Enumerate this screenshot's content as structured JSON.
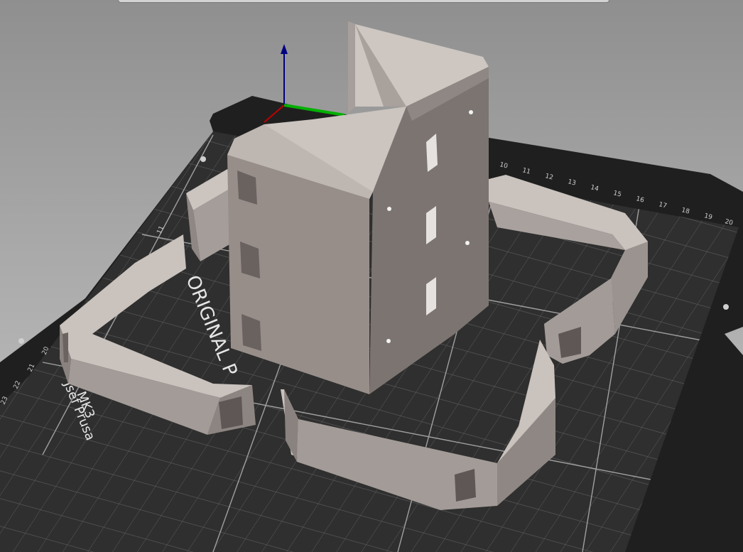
{
  "bed": {
    "logo_text": "ORIGINAL P",
    "model_text": "MK3",
    "maker_text": "Jsef Prusa",
    "ruler_top": [
      "10",
      "11",
      "12",
      "13",
      "14",
      "15",
      "16",
      "17",
      "18",
      "19",
      "20"
    ],
    "ruler_left": [
      "11",
      "20",
      "21",
      "22",
      "23"
    ]
  },
  "colors": {
    "bed_sheet": "#2e2e2e",
    "bed_frame": "#1e1e1e",
    "grid": "#6e6e6e",
    "grid_major": "#9a9a9a",
    "part_top": "#c9c2bd",
    "part_side": "#9d9490",
    "part_dark": "#7b7370",
    "axis_x": "#c00000",
    "axis_y": "#00b000",
    "axis_z": "#000080"
  },
  "icons": {
    "axis_gizmo": "xyz-axes-icon"
  }
}
